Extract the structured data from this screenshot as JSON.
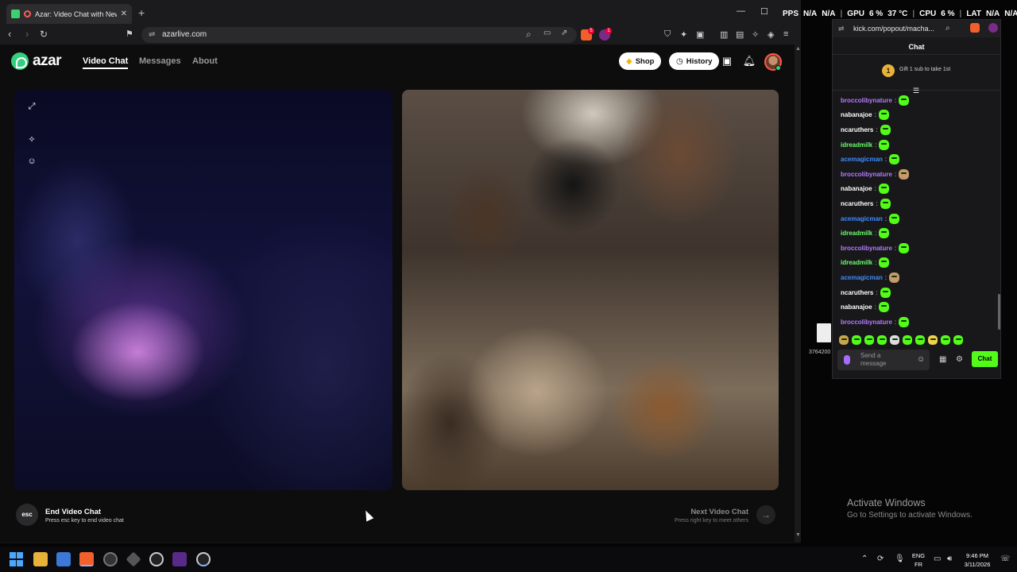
{
  "browser": {
    "tab_title": "Azar: Video Chat with New Pe",
    "url": "azarlive.com",
    "brave_badge": "5",
    "alert_badge": "1"
  },
  "azar": {
    "brand": "azar",
    "nav": {
      "video_chat": "Video Chat",
      "messages": "Messages",
      "about": "About"
    },
    "shop_label": "Shop",
    "history_label": "History",
    "notification_badge": "",
    "esc_key": "esc",
    "end_title": "End Video Chat",
    "end_sub": "Press esc key to end video chat",
    "next_title": "Next Video Chat",
    "next_sub": "Press right key to meet others"
  },
  "perf": {
    "fps_label": "PPS",
    "fps_a": "N/A",
    "fps_b": "N/A",
    "gpu_label": "GPU",
    "gpu_load": "6 %",
    "gpu_temp": "37 °C",
    "cpu_label": "CPU",
    "cpu_load": "6 %",
    "lat_label": "LAT",
    "lat_a": "N/A",
    "lat_b": "N/A"
  },
  "kick": {
    "url": "kick.com/popout/macha...",
    "chat_title": "Chat",
    "gift_count": "1",
    "gift_text": "Gift 1 sub to take 1st",
    "messages": [
      {
        "user": "broccolibynature",
        "color": "#b57bff"
      },
      {
        "user": "nabanajoe",
        "color": "#ffffff"
      },
      {
        "user": "ncaruthers",
        "color": "#ffffff"
      },
      {
        "user": "idreadmilk",
        "color": "#6cff6c"
      },
      {
        "user": "acemagicman",
        "color": "#3f8cff"
      },
      {
        "user": "broccolibynature",
        "color": "#b57bff"
      },
      {
        "user": "nabanajoe",
        "color": "#ffffff"
      },
      {
        "user": "ncaruthers",
        "color": "#ffffff"
      },
      {
        "user": "acemagicman",
        "color": "#3f8cff"
      },
      {
        "user": "idreadmilk",
        "color": "#6cff6c"
      },
      {
        "user": "broccolibynature",
        "color": "#b57bff"
      },
      {
        "user": "idreadmilk",
        "color": "#6cff6c"
      },
      {
        "user": "acemagicman",
        "color": "#3f8cff"
      },
      {
        "user": "ncaruthers",
        "color": "#ffffff"
      },
      {
        "user": "nabanajoe",
        "color": "#ffffff"
      },
      {
        "user": "broccolibynature",
        "color": "#b57bff"
      }
    ],
    "colon": ":",
    "input_placeholder": "Send a message",
    "send_label": "Chat"
  },
  "desktop": {
    "file_label": "3764200",
    "activate_title": "Activate Windows",
    "activate_sub": "Go to Settings to activate Windows."
  },
  "taskbar": {
    "lang_top": "ENG",
    "lang_bottom": "FR",
    "time": "9:46 PM",
    "date": "3/11/2026"
  },
  "colors": {
    "azar_green": "#35d07f",
    "kick_green": "#53fc18"
  }
}
